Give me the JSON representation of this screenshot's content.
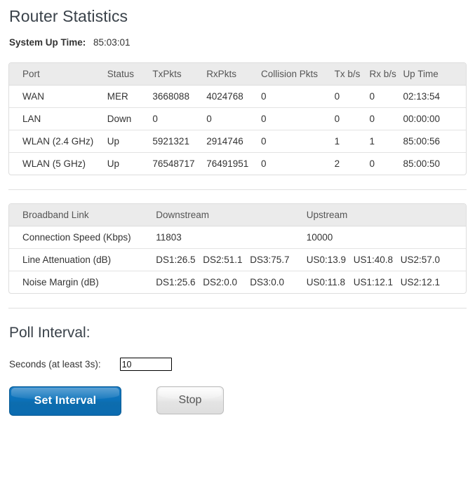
{
  "page": {
    "title": "Router Statistics"
  },
  "uptime": {
    "label": "System Up Time:",
    "value": "85:03:01"
  },
  "port_table": {
    "headers": [
      "Port",
      "Status",
      "TxPkts",
      "RxPkts",
      "Collision Pkts",
      "Tx b/s",
      "Rx b/s",
      "Up Time"
    ],
    "rows": [
      {
        "port": "WAN",
        "status": "MER",
        "tx_pkts": "3668088",
        "rx_pkts": "4024768",
        "collision_pkts": "0",
        "tx_bps": "0",
        "rx_bps": "0",
        "up_time": "02:13:54"
      },
      {
        "port": "LAN",
        "status": "Down",
        "tx_pkts": "0",
        "rx_pkts": "0",
        "collision_pkts": "0",
        "tx_bps": "0",
        "rx_bps": "0",
        "up_time": "00:00:00"
      },
      {
        "port": "WLAN (2.4 GHz)",
        "status": "Up",
        "tx_pkts": "5921321",
        "rx_pkts": "2914746",
        "collision_pkts": "0",
        "tx_bps": "1",
        "rx_bps": "1",
        "up_time": "85:00:56"
      },
      {
        "port": "WLAN (5 GHz)",
        "status": "Up",
        "tx_pkts": "76548717",
        "rx_pkts": "76491951",
        "collision_pkts": "0",
        "tx_bps": "2",
        "rx_bps": "0",
        "up_time": "85:00:50"
      }
    ]
  },
  "broadband_table": {
    "headers": [
      "Broadband Link",
      "Downstream",
      "Upstream"
    ],
    "rows": [
      {
        "metric": "Connection Speed (Kbps)",
        "downstream": [
          "11803"
        ],
        "upstream": [
          "10000"
        ]
      },
      {
        "metric": "Line Attenuation (dB)",
        "downstream": [
          "DS1:26.5",
          "DS2:51.1",
          "DS3:75.7"
        ],
        "upstream": [
          "US0:13.9",
          "US1:40.8",
          "US2:57.0"
        ]
      },
      {
        "metric": "Noise Margin (dB)",
        "downstream": [
          "DS1:25.6",
          "DS2:0.0",
          "DS3:0.0"
        ],
        "upstream": [
          "US0:11.8",
          "US1:12.1",
          "US2:12.1"
        ]
      }
    ]
  },
  "poll": {
    "title": "Poll Interval:",
    "seconds_label": "Seconds (at least 3s):",
    "seconds_value": "10",
    "seconds_placeholder": "",
    "set_button": "Set Interval",
    "stop_button": "Stop"
  },
  "colors": {
    "primary_button": "#0b72ba",
    "secondary_button": "#e8e8e8",
    "table_header_bg": "#ebebeb",
    "table_border": "#dddddd",
    "heading_text": "#3a424a"
  }
}
